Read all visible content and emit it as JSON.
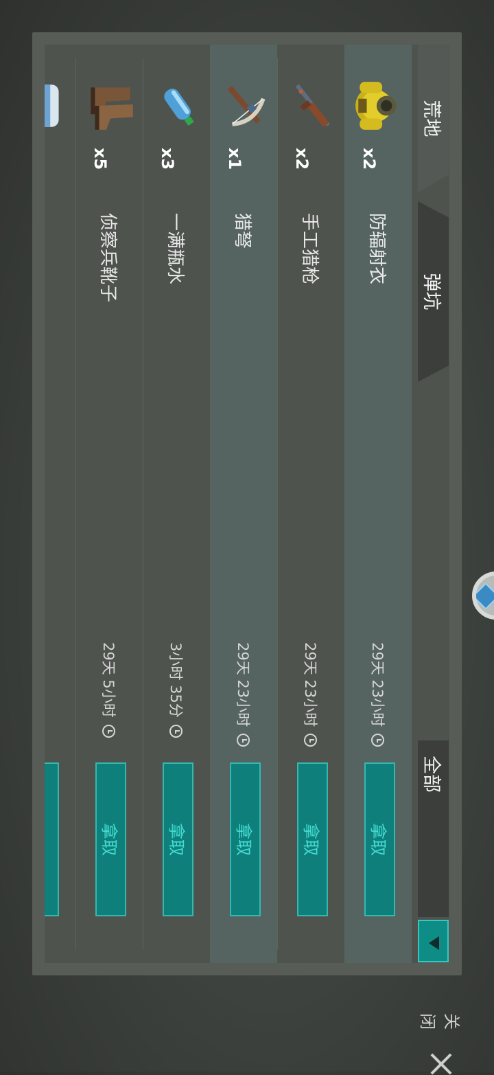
{
  "tabs": {
    "wasteland": "荒地",
    "crater": "弹坑",
    "filter": "全部"
  },
  "items": [
    {
      "name": "防辐射衣",
      "qty": "x2",
      "time": "29天 23小时",
      "icon": "hazmat-suit-icon",
      "action": "拿取"
    },
    {
      "name": "手工猎枪",
      "qty": "x2",
      "time": "29天 23小时",
      "icon": "hunting-rifle-icon",
      "action": "拿取"
    },
    {
      "name": "猎弩",
      "qty": "x1",
      "time": "29天 23小时",
      "icon": "crossbow-icon",
      "action": "拿取"
    },
    {
      "name": "一满瓶水",
      "qty": "x3",
      "time": "3小时 35分",
      "icon": "water-bottle-icon",
      "action": "拿取"
    },
    {
      "name": "侦察兵靴子",
      "qty": "x5",
      "time": "29天 5小时",
      "icon": "boots-icon",
      "action": "拿取"
    },
    {
      "name": "",
      "qty": "",
      "time": "",
      "icon": "bandage-icon",
      "action": ""
    }
  ],
  "close": {
    "label": "关闭"
  },
  "colors": {
    "accent": "#0e7f7a",
    "accent_text": "#44ddd3",
    "highlight": "#628c8a"
  }
}
